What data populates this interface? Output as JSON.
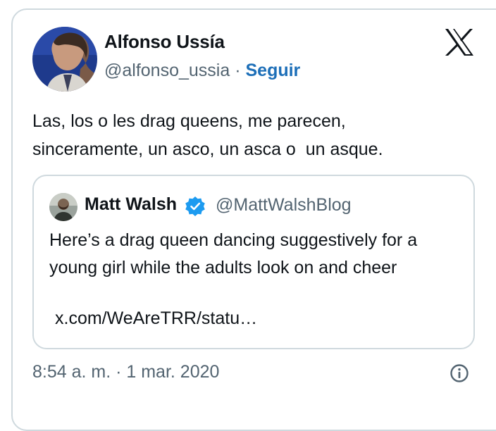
{
  "author": {
    "name": "Alfonso Ussía",
    "handle": "@alfonso_ussia",
    "separator": " · ",
    "follow_label": "Seguir"
  },
  "tweet": {
    "lines": [
      "Las, los o les drag queens, me parecen,",
      "sinceramente, un asco, un asca o  un asque."
    ],
    "timestamp": "8:54 a. m. · 1 mar. 2020"
  },
  "quoted": {
    "name": "Matt Walsh",
    "handle": "@MattWalshBlog",
    "lines": [
      "Here’s a drag queen dancing suggestively for a",
      "young girl while the adults look on and cheer"
    ],
    "link": "x.com/WeAreTRR/statu…"
  },
  "icons": {
    "platform_logo": "x-logo-icon",
    "verified": "verified-badge-icon",
    "info": "info-icon"
  },
  "colors": {
    "follow": "#1d6fb8",
    "verified": "#1d9bf0",
    "secondary_text": "#536471",
    "border": "#cfd9de"
  }
}
